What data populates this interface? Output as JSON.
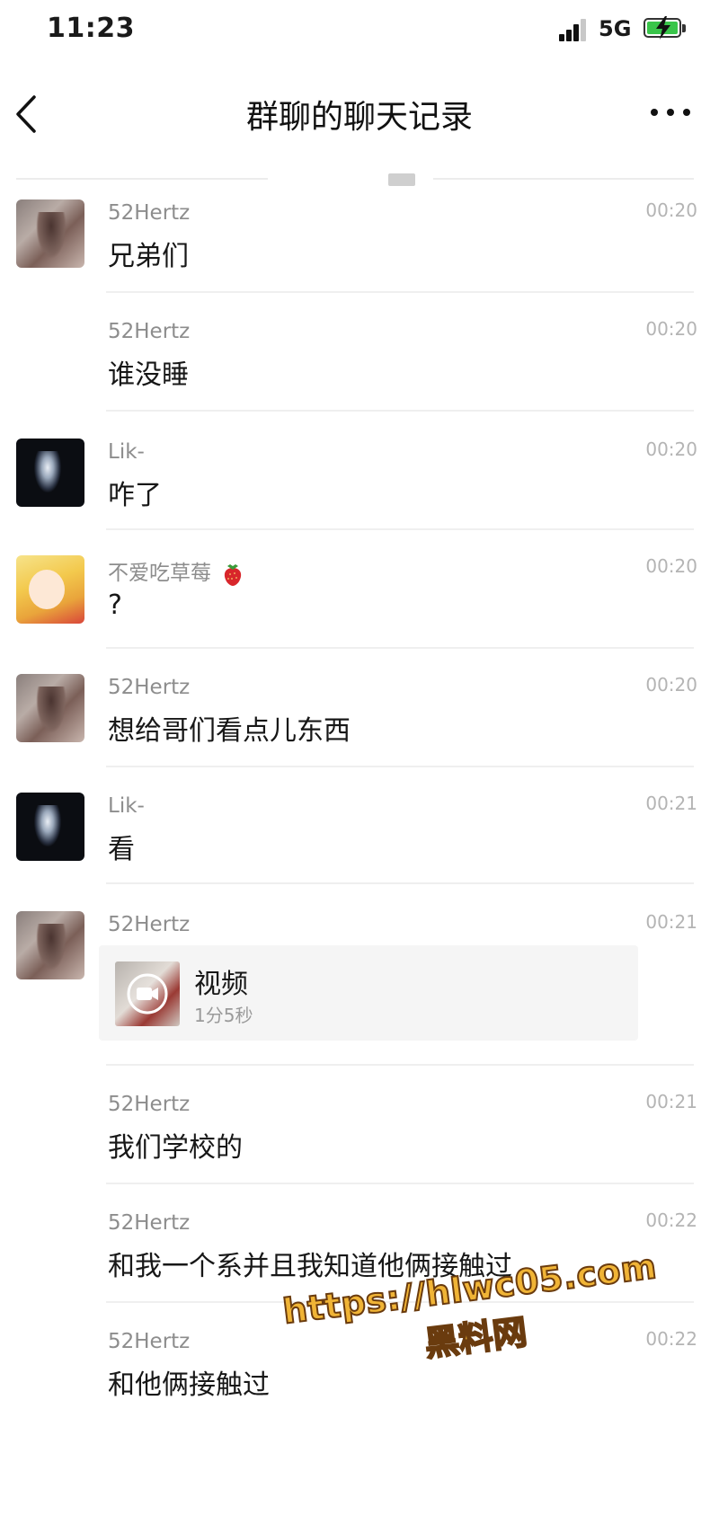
{
  "status_bar": {
    "time": "11:23",
    "network": "5G"
  },
  "nav": {
    "title": "群聊的聊天记录"
  },
  "messages": [
    {
      "sender": "52Hertz",
      "time": "00:20",
      "text": "兄弟们"
    },
    {
      "sender": "52Hertz",
      "time": "00:20",
      "text": "谁没睡"
    },
    {
      "sender": "Lik-",
      "time": "00:20",
      "text": "咋了"
    },
    {
      "sender": "不爱吃草莓",
      "time": "00:20",
      "text": "?"
    },
    {
      "sender": "52Hertz",
      "time": "00:20",
      "text": "想给哥们看点儿东西"
    },
    {
      "sender": "Lik-",
      "time": "00:21",
      "text": "看"
    },
    {
      "sender": "52Hertz",
      "time": "00:21",
      "video": {
        "title": "视频",
        "duration": "1分5秒"
      }
    },
    {
      "sender": "52Hertz",
      "time": "00:21",
      "text": "我们学校的"
    },
    {
      "sender": "52Hertz",
      "time": "00:22",
      "text": "和我一个系并且我知道他俩接触过"
    },
    {
      "sender": "52Hertz",
      "time": "00:22",
      "text": "和他俩接触过"
    }
  ],
  "watermark": {
    "url": "https://hlwc05.com",
    "name": "黑料网"
  },
  "icons": {
    "back": "chevron-left-icon",
    "more": "more-dots-icon",
    "signal": "signal-icon",
    "battery": "battery-charging-icon",
    "video": "video-camera-icon",
    "emoji": "strawberry-emoji-icon"
  },
  "colors": {
    "battery_fill": "#39c54a",
    "watermark": "#f0b436"
  }
}
